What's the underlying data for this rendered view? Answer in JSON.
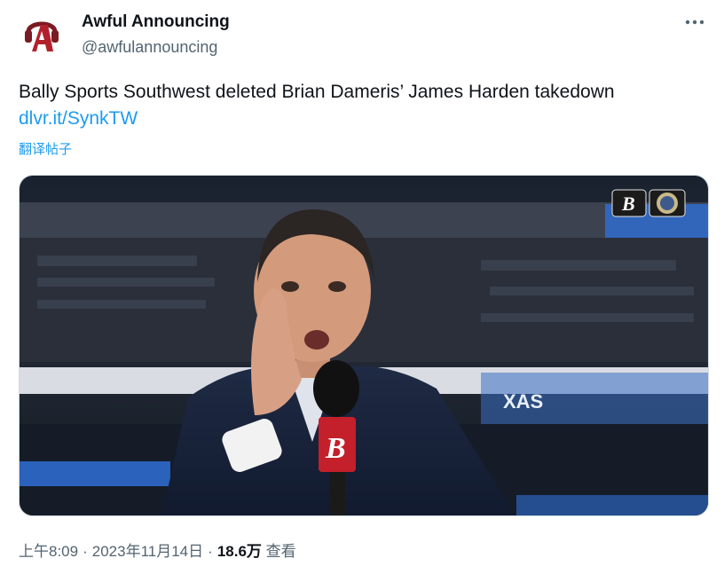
{
  "author": {
    "name": "Awful Announcing",
    "handle": "@awfulannouncing"
  },
  "tweet": {
    "text": "Bally Sports Southwest deleted Brian Dameris’ James Harden takedown",
    "link": "dlvr.it/SynkTW",
    "translate_label": "翻译帖子"
  },
  "media": {
    "network_logo_letter": "B",
    "banner_text": "XAS",
    "mic_flag_letter": "B"
  },
  "meta": {
    "time": "上午8:09",
    "date": "2023年11月14日",
    "views_count": "18.6万",
    "views_label": "查看"
  },
  "colors": {
    "link": "#1d9bf0",
    "secondary_text": "#536471",
    "brand_red": "#c4202b"
  },
  "icons": {
    "more": "more-horizontal-icon",
    "avatar": "awful-announcing-logo"
  }
}
